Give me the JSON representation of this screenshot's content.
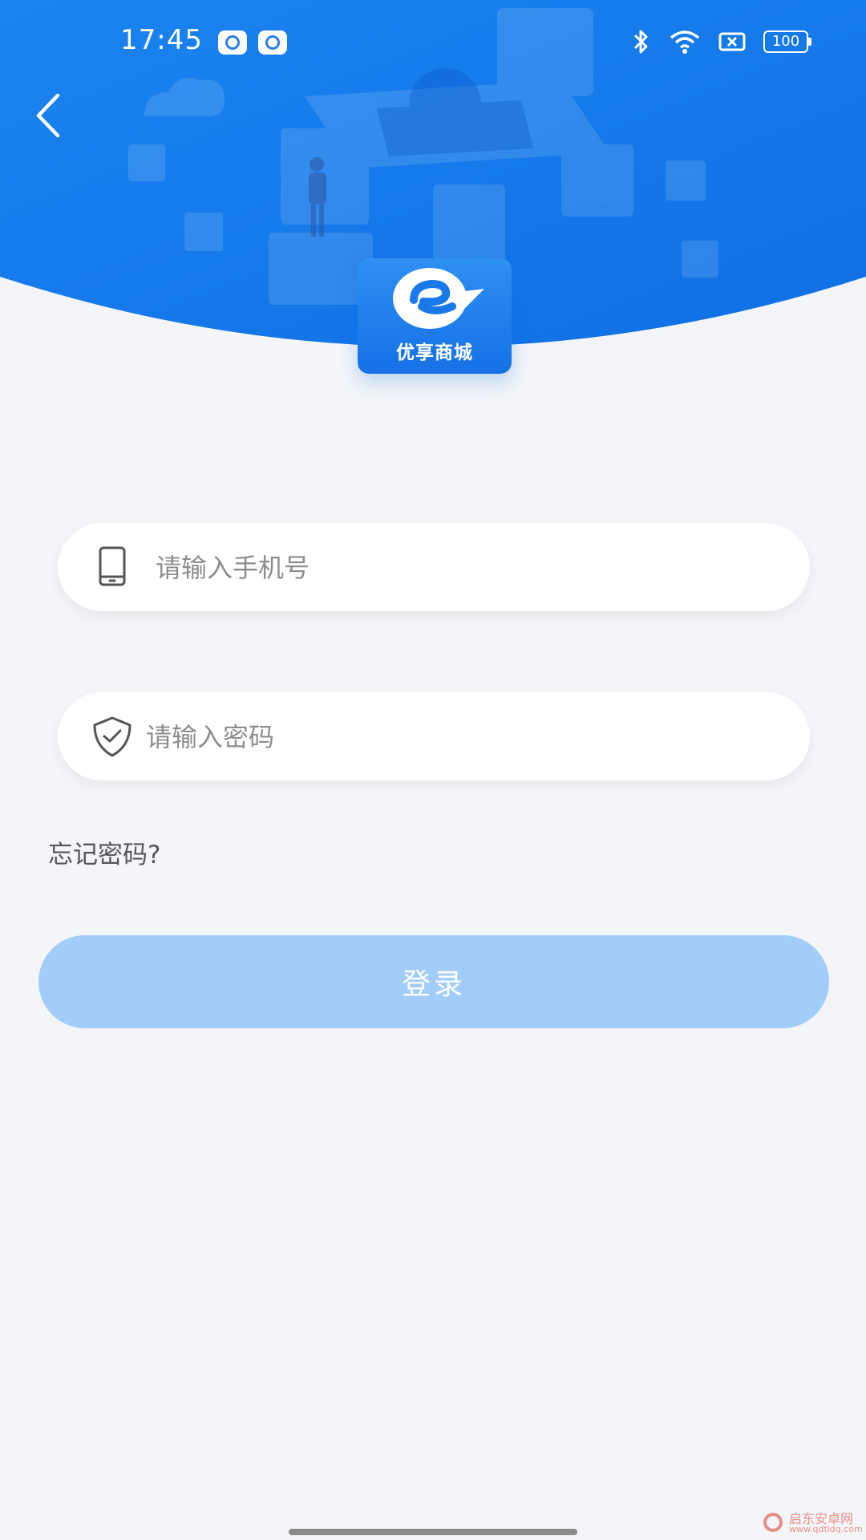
{
  "status_bar": {
    "time": "17:45",
    "battery": "100",
    "icons": [
      "bluetooth-icon",
      "wifi-icon",
      "sim-off-icon",
      "battery-icon"
    ]
  },
  "header": {
    "back_icon": "chevron-left-icon",
    "logo_text": "优享商城"
  },
  "form": {
    "phone": {
      "placeholder": "请输入手机号",
      "value": "",
      "icon": "phone-icon"
    },
    "password": {
      "placeholder": "请输入密码",
      "value": "",
      "icon": "shield-check-icon"
    },
    "forgot_label": "忘记密码?",
    "login_label": "登录"
  },
  "watermark": {
    "name": "启东安卓网",
    "url": "www.qdtldq.com"
  },
  "colors": {
    "primary": "#1a79ea",
    "login_button_disabled": "#a2cdfa",
    "background": "#f3f5f8"
  }
}
